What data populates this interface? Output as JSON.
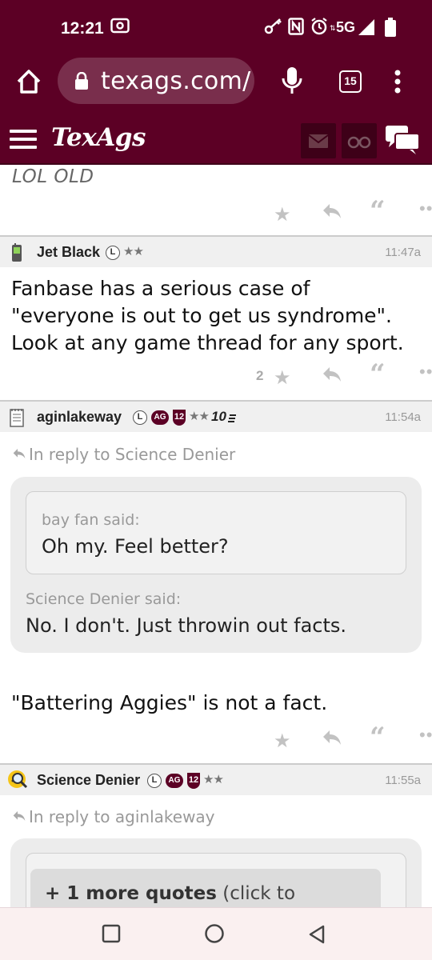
{
  "status_bar": {
    "time": "12:21",
    "network": "5G"
  },
  "browser": {
    "url": "texags.com/",
    "tab_count": "15"
  },
  "site": {
    "logo": "TexAgs"
  },
  "previous_post": {
    "text": "LOL OLD"
  },
  "posts": [
    {
      "username": "Jet Black",
      "badge_l": "L",
      "stars": "★★",
      "time": "11:47a",
      "body": "Fanbase has a serious case of \"everyone is out to get us syndrome\". Look at any game thread for any sport.",
      "star_count": "2"
    },
    {
      "username": "aginlakeway",
      "badge_l": "L",
      "badge_ag": "AG",
      "badge_12": "12",
      "stars": "★★",
      "ten_badge": "10",
      "time": "11:54a",
      "reply_to": "In reply to Science Denier",
      "quote_outer_said": "bay fan said:",
      "quote_outer_text": "Oh my. Feel better?",
      "quote_said": "Science Denier said:",
      "quote_text": "No. I don't. Just throwin out facts.",
      "body": "\"Battering Aggies\" is not a fact."
    },
    {
      "username": "Science Denier",
      "badge_l": "L",
      "badge_ag": "AG",
      "badge_12": "12",
      "stars": "★★",
      "time": "11:55a",
      "reply_to": "In reply to aginlakeway",
      "more_quotes_bold": "+ 1 more quotes",
      "more_quotes_rest": " (click to"
    }
  ],
  "colors": {
    "maroon": "#5c0025",
    "icon_gray": "#c2c2c2"
  }
}
